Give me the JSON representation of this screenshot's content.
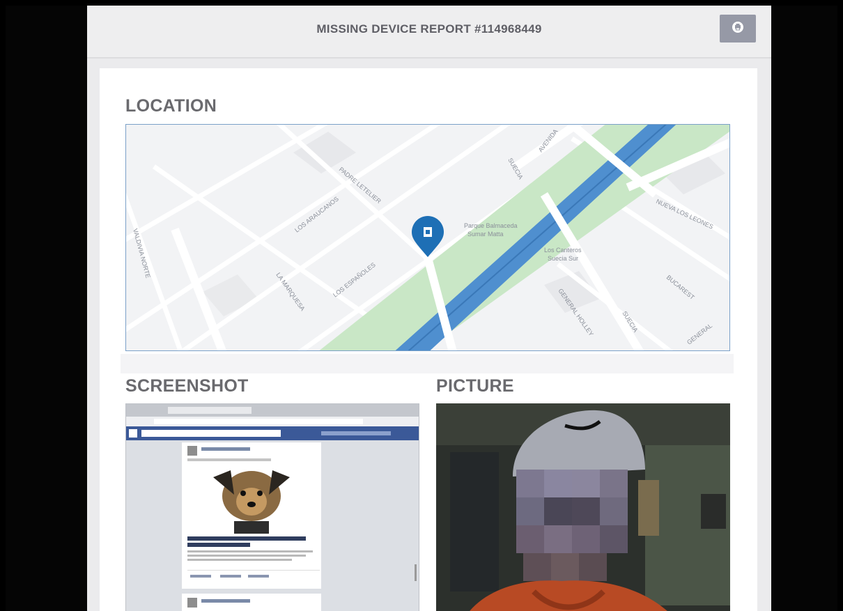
{
  "header": {
    "title": "MISSING DEVICE REPORT #114968449",
    "print_icon": "print-icon"
  },
  "sections": {
    "location": "LOCATION",
    "screenshot": "SCREENSHOT",
    "picture": "PICTURE"
  },
  "map": {
    "streets": [
      "VALDIVIA NORTE",
      "LOS ARAUCANOS",
      "PADRE LETELIER",
      "LOS ESPAÑOLES",
      "LA MARQUESA",
      "SUECIA",
      "AVENIDA",
      "NUEVA LOS LEONES",
      "BUCAREST",
      "GENERAL HOLLEY",
      "GENERAL"
    ],
    "places": [
      "Parque Balmaceda",
      "Sumar Matta",
      "Los Canteros",
      "Suecia Sur"
    ],
    "marker_icon": "map-pin-icon"
  },
  "colors": {
    "header_text": "#5f5f66",
    "section_title": "#6a6a6e",
    "print_button": "#9699a6",
    "marker": "#1e6fb5",
    "river": "#4f8fcf",
    "park": "#c9e7c6",
    "map_border": "#7aa0c8"
  }
}
